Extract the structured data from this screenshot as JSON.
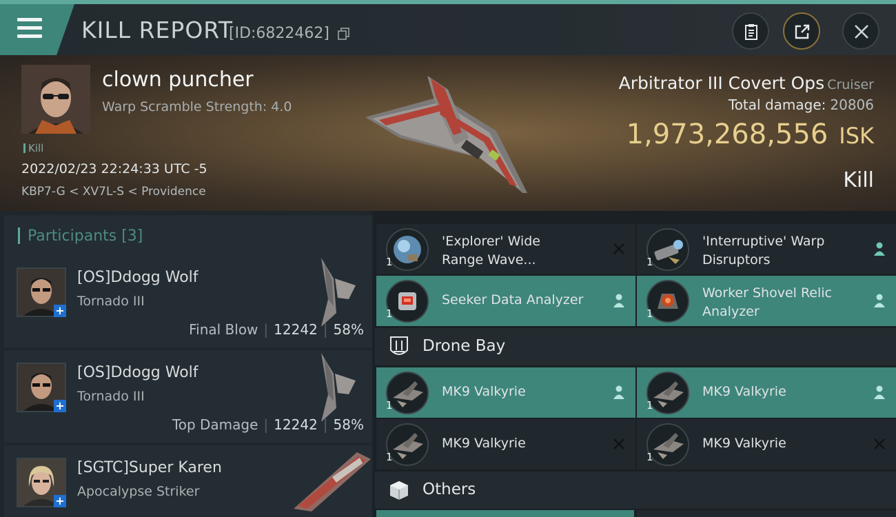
{
  "header": {
    "title": "KILL REPORT",
    "report_id": "[ID:6822462]"
  },
  "victim": {
    "name": "clown puncher",
    "warp_scramble": "Warp Scramble Strength: 4.0",
    "tag": "Kill",
    "datetime": "2022/02/23 22:24:33 UTC -5",
    "location": "KBP7-G < XV7L-S < Providence",
    "ship_name": "Arbitrator III Covert Ops",
    "ship_class": "Cruiser",
    "total_damage_label": "Total damage:",
    "total_damage_value": "20806",
    "isk_value": "1,973,268,556",
    "isk_unit": "ISK",
    "outcome": "Kill"
  },
  "participants": {
    "title": "Participants [3]",
    "items": [
      {
        "name": "[OS]Ddogg Wolf",
        "ship": "Tornado III",
        "label": "Final Blow",
        "damage": "12242",
        "percent": "58%"
      },
      {
        "name": "[OS]Ddogg Wolf",
        "ship": "Tornado III",
        "label": "Top Damage",
        "damage": "12242",
        "percent": "58%"
      },
      {
        "name": "[SGTC]Super Karen",
        "ship": "Apocalypse Striker",
        "label": "",
        "damage": "",
        "percent": ""
      }
    ]
  },
  "items": {
    "list": [
      {
        "name_line1": "'Explorer' Wide",
        "name_line2": "Range Wave...",
        "qty": "1",
        "status": "destroyed",
        "icon": "scanner-probe-icon"
      },
      {
        "name_line1": "'Interruptive' Warp",
        "name_line2": "Disruptors",
        "qty": "1",
        "status": "dropped",
        "icon": "warp-disruptor-icon"
      },
      {
        "name_line1": "Seeker Data Analyzer",
        "name_line2": "",
        "qty": "1",
        "status": "dropped",
        "icon": "data-analyzer-icon"
      },
      {
        "name_line1": "Worker Shovel Relic",
        "name_line2": "Analyzer",
        "qty": "1",
        "status": "dropped",
        "icon": "relic-analyzer-icon"
      }
    ],
    "drone_bay_title": "Drone Bay",
    "drones": [
      {
        "name": "MK9  Valkyrie",
        "qty": "1",
        "status": "dropped"
      },
      {
        "name": "MK9  Valkyrie",
        "qty": "1",
        "status": "dropped"
      },
      {
        "name": "MK9  Valkyrie",
        "qty": "1",
        "status": "destroyed"
      },
      {
        "name": "MK9  Valkyrie",
        "qty": "1",
        "status": "destroyed"
      }
    ],
    "others_title": "Others"
  },
  "colors": {
    "accent": "#5ea89c",
    "highlight": "#3e857a",
    "isk_gold": "#e7cf8e",
    "badge_blue": "#1f6fd0"
  }
}
